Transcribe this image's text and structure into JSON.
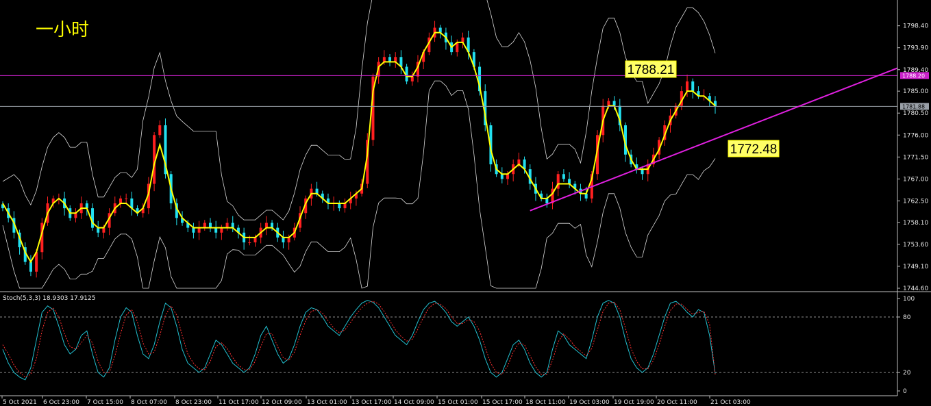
{
  "colors": {
    "background": "#000000",
    "bull_candle": "#ff2020",
    "bear_candle": "#22e0f0",
    "ma": "#ffff00",
    "bands": "#d8d8d8",
    "horizontal_line": "#cc22cc",
    "trend_line": "#e020e0",
    "current_price_line": "#9aa0a8",
    "stoch_main": "#22c0d0",
    "stoch_signal": "#ff3030",
    "axis_text": "#e6e6e6"
  },
  "chart_data": [
    {
      "type": "candlestick",
      "title": "一小时",
      "ylim": [
        1744.6,
        1802.0
      ],
      "yticks": [
        "1798.40",
        "1793.90",
        "1789.40",
        "1785.00",
        "1780.50",
        "1776.00",
        "1771.50",
        "1767.00",
        "1762.50",
        "1758.10",
        "1753.60",
        "1749.10",
        "1744.60"
      ],
      "x_tick_labels": [
        "5 Oct 2021",
        "6 Oct 23:00",
        "7 Oct 15:00",
        "8 Oct 07:00",
        "8 Oct 23:00",
        "11 Oct 17:00",
        "12 Oct 09:00",
        "13 Oct 01:00",
        "13 Oct 17:00",
        "14 Oct 09:00",
        "15 Oct 01:00",
        "15 Oct 17:00",
        "18 Oct 11:00",
        "19 Oct 03:00",
        "19 Oct 19:00",
        "20 Oct 11:00",
        "21 Oct 03:00"
      ],
      "close_series": [
        1761,
        1759,
        1756,
        1753,
        1750,
        1748,
        1752,
        1758,
        1762,
        1763,
        1763,
        1761,
        1759,
        1760,
        1762,
        1761,
        1757,
        1756,
        1757,
        1760,
        1762,
        1763,
        1763,
        1761,
        1760,
        1761,
        1766,
        1776,
        1778,
        1768,
        1762,
        1759,
        1758,
        1757,
        1756,
        1757,
        1758,
        1757,
        1756,
        1757,
        1758,
        1757,
        1756,
        1754,
        1754,
        1755,
        1757,
        1758,
        1757,
        1755,
        1754,
        1755,
        1757,
        1760,
        1763,
        1765,
        1764,
        1763,
        1762,
        1762,
        1761,
        1762,
        1763,
        1764,
        1766,
        1775,
        1788,
        1791,
        1792,
        1791,
        1792,
        1790,
        1787,
        1788,
        1791,
        1793,
        1796,
        1798,
        1797,
        1795,
        1793,
        1795,
        1796,
        1793,
        1790,
        1785,
        1778,
        1770,
        1768,
        1767,
        1768,
        1770,
        1771,
        1769,
        1766,
        1764,
        1763,
        1762,
        1765,
        1768,
        1767,
        1766,
        1765,
        1764,
        1763,
        1768,
        1776,
        1782,
        1783,
        1782,
        1778,
        1772,
        1770,
        1769,
        1768,
        1770,
        1772,
        1775,
        1778,
        1780,
        1782,
        1785,
        1787,
        1785,
        1784,
        1784,
        1783,
        1781.88
      ],
      "ma_series": [
        1762,
        1760,
        1758,
        1755,
        1752,
        1750,
        1752,
        1756,
        1760,
        1762,
        1763,
        1762,
        1760,
        1760,
        1761,
        1761,
        1758,
        1757,
        1757,
        1759,
        1761,
        1762,
        1762,
        1761,
        1760,
        1761,
        1764,
        1770,
        1774,
        1770,
        1765,
        1761,
        1759,
        1758,
        1757,
        1757,
        1757,
        1757,
        1757,
        1757,
        1757,
        1757,
        1756,
        1755,
        1755,
        1755,
        1756,
        1757,
        1757,
        1756,
        1755,
        1755,
        1756,
        1759,
        1762,
        1764,
        1764,
        1763,
        1762,
        1762,
        1762,
        1762,
        1763,
        1764,
        1765,
        1772,
        1785,
        1790,
        1791,
        1791,
        1791,
        1790,
        1788,
        1788,
        1790,
        1793,
        1795,
        1797,
        1797,
        1796,
        1794,
        1795,
        1795,
        1793,
        1790,
        1786,
        1780,
        1773,
        1769,
        1768,
        1768,
        1769,
        1770,
        1769,
        1767,
        1765,
        1763,
        1763,
        1764,
        1766,
        1766,
        1766,
        1765,
        1764,
        1764,
        1767,
        1773,
        1779,
        1782,
        1782,
        1779,
        1774,
        1771,
        1769,
        1769,
        1769,
        1771,
        1773,
        1776,
        1779,
        1781,
        1783,
        1785,
        1785,
        1784,
        1784,
        1783,
        1782
      ],
      "annotations": [
        "1788.21",
        "1772.48"
      ],
      "price_boxes": [
        {
          "label": "1788.20",
          "price": 1788.2,
          "color": "#cc22cc",
          "text_color": "#ffffff"
        },
        {
          "label": "1781.88",
          "price": 1781.88,
          "color": "#9aa0a8",
          "text_color": "#000000"
        }
      ],
      "horizontal_line_price": 1788.2,
      "current_price": 1781.88,
      "trend_line": {
        "from": {
          "bar": 94,
          "price": 1760.5
        },
        "to": {
          "bar": 150,
          "price": 1785.5
        }
      }
    },
    {
      "type": "line",
      "title": "Stoch(5,3,3) 18.9303 17.9125",
      "ylim": [
        0,
        100
      ],
      "yticks": [
        "100",
        "80",
        "20",
        "0"
      ],
      "levels": [
        80,
        20
      ],
      "series": [
        {
          "values": [
            45,
            30,
            20,
            15,
            12,
            25,
            55,
            85,
            92,
            88,
            70,
            50,
            40,
            45,
            60,
            65,
            40,
            20,
            15,
            25,
            55,
            80,
            90,
            85,
            60,
            40,
            35,
            50,
            75,
            95,
            90,
            70,
            45,
            30,
            25,
            20,
            25,
            40,
            55,
            50,
            40,
            30,
            25,
            20,
            25,
            40,
            60,
            70,
            55,
            40,
            30,
            35,
            50,
            70,
            85,
            90,
            88,
            80,
            70,
            65,
            60,
            70,
            80,
            88,
            95,
            98,
            96,
            90,
            80,
            70,
            60,
            55,
            50,
            60,
            75,
            88,
            95,
            97,
            92,
            85,
            75,
            70,
            75,
            80,
            70,
            55,
            35,
            20,
            15,
            20,
            35,
            50,
            55,
            45,
            30,
            20,
            15,
            20,
            45,
            65,
            60,
            50,
            45,
            40,
            35,
            55,
            80,
            95,
            98,
            95,
            80,
            55,
            35,
            25,
            20,
            25,
            40,
            60,
            80,
            95,
            97,
            92,
            85,
            80,
            88,
            85,
            60,
            18.93
          ]
        },
        {
          "values": [
            50,
            40,
            28,
            20,
            15,
            18,
            35,
            65,
            85,
            90,
            80,
            62,
            48,
            45,
            52,
            60,
            52,
            32,
            20,
            20,
            38,
            62,
            82,
            88,
            75,
            52,
            40,
            42,
            60,
            82,
            92,
            82,
            60,
            40,
            30,
            24,
            23,
            32,
            48,
            52,
            46,
            36,
            28,
            23,
            23,
            32,
            48,
            62,
            62,
            48,
            36,
            33,
            42,
            60,
            76,
            86,
            88,
            84,
            76,
            68,
            63,
            66,
            74,
            83,
            90,
            95,
            97,
            94,
            86,
            76,
            66,
            59,
            54,
            56,
            67,
            80,
            90,
            95,
            94,
            89,
            80,
            73,
            73,
            77,
            75,
            65,
            47,
            30,
            20,
            18,
            27,
            42,
            52,
            50,
            38,
            26,
            18,
            18,
            33,
            53,
            62,
            56,
            48,
            43,
            38,
            46,
            66,
            86,
            95,
            96,
            88,
            68,
            46,
            32,
            24,
            24,
            33,
            50,
            70,
            87,
            94,
            94,
            88,
            83,
            85,
            86,
            72,
            17.91
          ]
        }
      ]
    }
  ]
}
